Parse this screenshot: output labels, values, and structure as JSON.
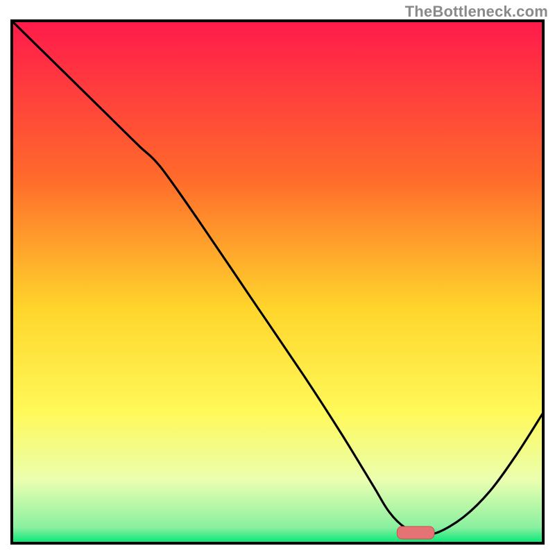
{
  "watermark": {
    "text": "TheBottleneck.com"
  },
  "colors": {
    "border": "#000000",
    "curve": "#000000",
    "marker_fill": "#e57373",
    "grad_top": "#ff1a4b",
    "grad_mid_upper": "#ff8a2b",
    "grad_mid": "#ffe52b",
    "grad_low": "#f6ff8c",
    "grad_near_bottom": "#d4ffb0",
    "grad_bottom": "#00e676"
  },
  "chart_data": {
    "type": "line",
    "title": "",
    "xlabel": "",
    "ylabel": "",
    "xlim": [
      0,
      100
    ],
    "ylim": [
      0,
      100
    ],
    "series": [
      {
        "name": "bottleneck-curve",
        "x": [
          0,
          5,
          10,
          15,
          20,
          24,
          28,
          35,
          45,
          55,
          62,
          68,
          71,
          74,
          77,
          80,
          85,
          90,
          95,
          100
        ],
        "y": [
          100,
          95,
          90,
          85,
          80,
          76,
          72,
          62,
          47,
          32,
          21,
          11,
          6,
          3,
          2,
          2,
          5,
          10,
          17,
          25
        ]
      }
    ],
    "marker": {
      "name": "optimal-point",
      "x_center": 76,
      "y": 2,
      "width": 7,
      "height": 2.4
    },
    "background_gradient": {
      "stops": [
        {
          "offset": 0.0,
          "color": "#ff1a4b"
        },
        {
          "offset": 0.3,
          "color": "#ff6a2b"
        },
        {
          "offset": 0.55,
          "color": "#ffd52b"
        },
        {
          "offset": 0.75,
          "color": "#fff95a"
        },
        {
          "offset": 0.88,
          "color": "#eaffb0"
        },
        {
          "offset": 0.97,
          "color": "#89f0a0"
        },
        {
          "offset": 1.0,
          "color": "#00e676"
        }
      ]
    }
  }
}
